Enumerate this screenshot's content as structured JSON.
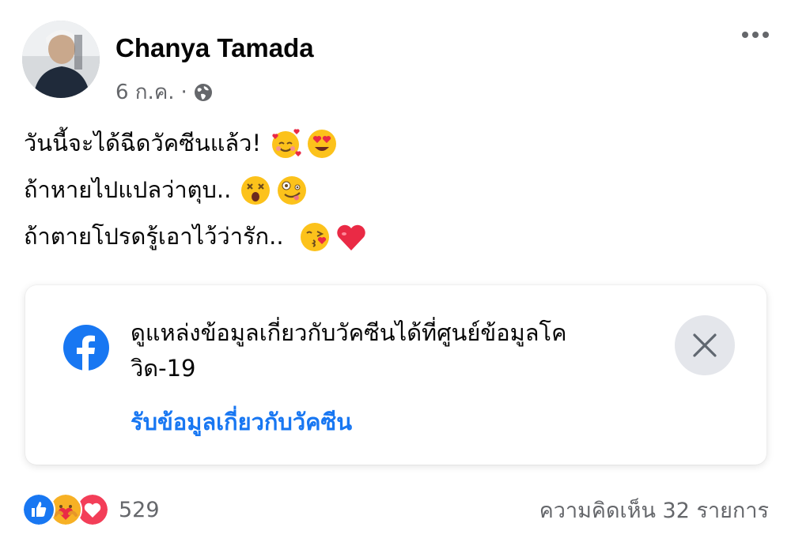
{
  "post": {
    "author": "Chanya Tamada",
    "date": "6 ก.ค.",
    "separator": "·",
    "audience_icon": "globe-icon",
    "menu_icon": "more-options-icon",
    "lines": [
      {
        "text": "วันนี้จะได้ฉีดวัคซีนแล้ว!",
        "emojis": [
          "smiling-face-with-hearts-emoji",
          "heart-eyes-emoji"
        ]
      },
      {
        "text": "ถ้าหายไปแปลว่าตุบ..",
        "emojis": [
          "dizzy-face-emoji",
          "zany-face-emoji"
        ]
      },
      {
        "text": "ถ้าตายโปรดรู้เอาไว้ว่ารัก..",
        "emojis": [
          "kissing-heart-emoji",
          "red-heart-emoji"
        ]
      }
    ]
  },
  "info_card": {
    "icon": "facebook-logo-icon",
    "text_line1": "ดูแหล่งข้อมูลเกี่ยวกับวัคซีนได้ที่ศูนย์ข้อมูลโค",
    "text_line2": "วิด-19",
    "link": "รับข้อมูลเกี่ยวกับวัคซีน",
    "close_icon": "close-icon"
  },
  "footer": {
    "reactions": [
      "like-reaction-icon",
      "care-reaction-icon",
      "love-reaction-icon"
    ],
    "reaction_count": "529",
    "comments": "ความคิดเห็น 32 รายการ"
  },
  "colors": {
    "link": "#1877f2",
    "secondary_text": "#65676b",
    "close_bg": "#e4e6eb"
  }
}
